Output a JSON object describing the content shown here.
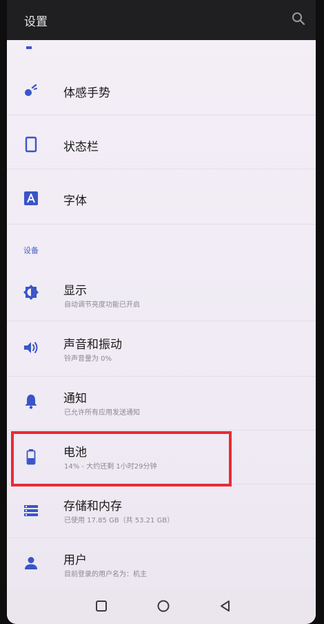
{
  "appbar": {
    "title": "设置",
    "search_icon": "search-icon"
  },
  "items": [
    {
      "id": "motion-gestures",
      "icon": "motion-gesture-icon",
      "title": "体感手势",
      "summary": ""
    },
    {
      "id": "status-bar",
      "icon": "phone-frame-icon",
      "title": "状态栏",
      "summary": ""
    },
    {
      "id": "font",
      "icon": "font-a-icon",
      "title": "字体",
      "summary": ""
    }
  ],
  "section": {
    "label": "设备"
  },
  "device_items": [
    {
      "id": "display",
      "icon": "brightness-icon",
      "title": "显示",
      "summary": "自动调节亮度功能已开启"
    },
    {
      "id": "sound",
      "icon": "volume-icon",
      "title": "声音和振动",
      "summary": "铃声音量为 0%"
    },
    {
      "id": "notifications",
      "icon": "bell-icon",
      "title": "通知",
      "summary": "已允许所有应用发送通知"
    },
    {
      "id": "battery",
      "icon": "battery-icon",
      "title": "电池",
      "summary": "14% - 大约还剩 1小时29分钟"
    },
    {
      "id": "storage",
      "icon": "storage-icon",
      "title": "存储和内存",
      "summary": "已使用 17.85 GB（共 53.21 GB）"
    },
    {
      "id": "users",
      "icon": "person-icon",
      "title": "用户",
      "summary": "目前登录的用户名为：机主"
    }
  ],
  "navbar": {
    "recents_icon": "square-icon",
    "home_icon": "circle-icon",
    "back_icon": "triangle-back-icon"
  },
  "colors": {
    "accent": "#3a55c8",
    "highlight_box": "#ea2a35",
    "appbar": "#1f1f21"
  }
}
